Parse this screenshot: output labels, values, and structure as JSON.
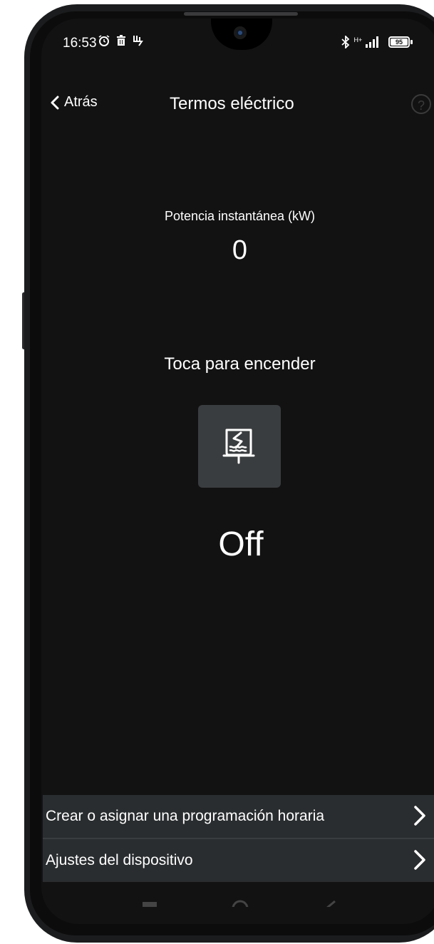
{
  "status_bar": {
    "time": "16:53",
    "left_icons": "⏰ 🗑 ⚡",
    "network": "H+",
    "battery": "95"
  },
  "header": {
    "back_label": "Atrás",
    "title": "Termos eléctrico",
    "help_label": "?"
  },
  "power": {
    "label": "Potencia instantánea (kW)",
    "value": "0"
  },
  "control": {
    "instruction": "Toca para encender",
    "device_icon": "water-heater-icon",
    "state": "Off"
  },
  "menu": {
    "items": [
      {
        "label": "Crear o asignar una programación horaria"
      },
      {
        "label": "Ajustes del dispositivo"
      }
    ]
  },
  "colors": {
    "background": "#121213",
    "button": "#3a3d3f",
    "menu_row": "#2a2d2f",
    "text": "#ffffff"
  }
}
